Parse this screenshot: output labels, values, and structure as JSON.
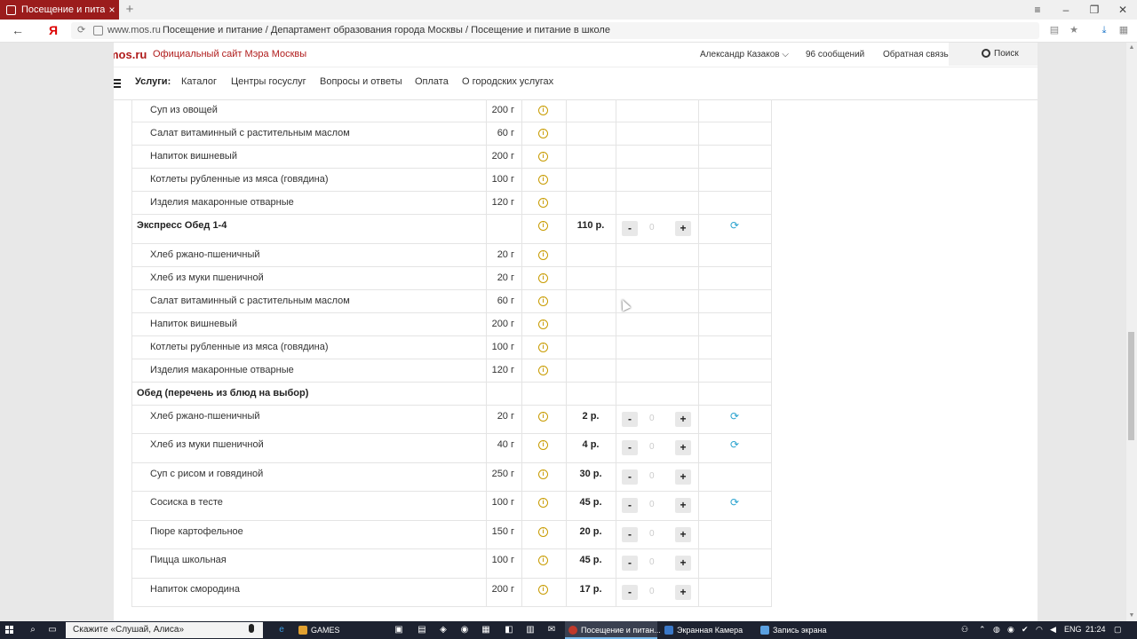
{
  "browser": {
    "tab_title": "Посещение и питание /",
    "tab_close": "×",
    "new_tab": "+",
    "window_controls": [
      "≡",
      "–",
      "❐",
      "✕"
    ],
    "url_domain": "www.mos.ru",
    "url_title": "Посещение и питание / Департамент образования города Москвы / Посещение и питание в школе",
    "back": "←",
    "yandex": "Я"
  },
  "site": {
    "logo": "mos.ru",
    "logo_sub": "Официальный сайт Мэра Москвы",
    "user": "Александр Казаков ⌵",
    "messages": "96 сообщений",
    "feedback": "Обратная связь",
    "search": "Поиск",
    "nav_label": "Услуги:",
    "nav": [
      "Каталог",
      "Центры госуслуг",
      "Вопросы и ответы",
      "Оплата",
      "О городских услугах"
    ]
  },
  "menu": {
    "rows": [
      {
        "type": "item",
        "name": "Суп из овощей",
        "weight": "200 г"
      },
      {
        "type": "item",
        "name": "Салат витаминный с растительным маслом",
        "weight": "60 г"
      },
      {
        "type": "item",
        "name": "Напиток вишневый",
        "weight": "200 г"
      },
      {
        "type": "item",
        "name": "Котлеты рубленные из мяса (говядина)",
        "weight": "100 г"
      },
      {
        "type": "item",
        "name": "Изделия макаронные отварные",
        "weight": "120 г"
      },
      {
        "type": "group",
        "name": "Экспресс Обед 1-4",
        "price": "110 р.",
        "qty": "0",
        "refresh": true
      },
      {
        "type": "item",
        "name": "Хлеб ржано-пшеничный",
        "weight": "20 г"
      },
      {
        "type": "item",
        "name": "Хлеб из муки пшеничной",
        "weight": "20 г"
      },
      {
        "type": "item",
        "name": "Салат витаминный с растительным маслом",
        "weight": "60 г"
      },
      {
        "type": "item",
        "name": "Напиток вишневый",
        "weight": "200 г"
      },
      {
        "type": "item",
        "name": "Котлеты рубленные из мяса (говядина)",
        "weight": "100 г"
      },
      {
        "type": "item",
        "name": "Изделия макаронные отварные",
        "weight": "120 г"
      },
      {
        "type": "group-header",
        "name": "Обед (перечень из блюд на выбор)"
      },
      {
        "type": "priced",
        "name": "Хлеб ржано-пшеничный",
        "weight": "20 г",
        "price": "2 р.",
        "qty": "0",
        "refresh": true
      },
      {
        "type": "priced",
        "name": "Хлеб из муки пшеничной",
        "weight": "40 г",
        "price": "4 р.",
        "qty": "0",
        "refresh": true
      },
      {
        "type": "priced",
        "name": "Суп с рисом и говядиной",
        "weight": "250 г",
        "price": "30 р.",
        "qty": "0",
        "refresh": false
      },
      {
        "type": "priced",
        "name": "Сосиска в тесте",
        "weight": "100 г",
        "price": "45 р.",
        "qty": "0",
        "refresh": true
      },
      {
        "type": "priced",
        "name": "Пюре картофельное",
        "weight": "150 г",
        "price": "20 р.",
        "qty": "0",
        "refresh": false
      },
      {
        "type": "priced",
        "name": "Пицца школьная",
        "weight": "100 г",
        "price": "45 р.",
        "qty": "0",
        "refresh": false
      },
      {
        "type": "priced",
        "name": "Напиток смородина",
        "weight": "200 г",
        "price": "17 р.",
        "qty": "0",
        "refresh": false
      }
    ],
    "minus_label": "-",
    "plus_label": "+",
    "info_glyph": "i",
    "refresh_glyph": "⟳"
  },
  "taskbar": {
    "search_text": "Скажите «Слушай, Алиса»",
    "apps": [
      {
        "label": "GAMES",
        "color": "#e0a030"
      },
      {
        "label": "Посещение и питан...",
        "color": "#c0392b"
      },
      {
        "label": "Экранная Камера",
        "color": "#3a78c8"
      },
      {
        "label": "Запись экрана",
        "color": "#5aa0e0"
      }
    ],
    "lang": "ENG",
    "time": "21:24"
  }
}
